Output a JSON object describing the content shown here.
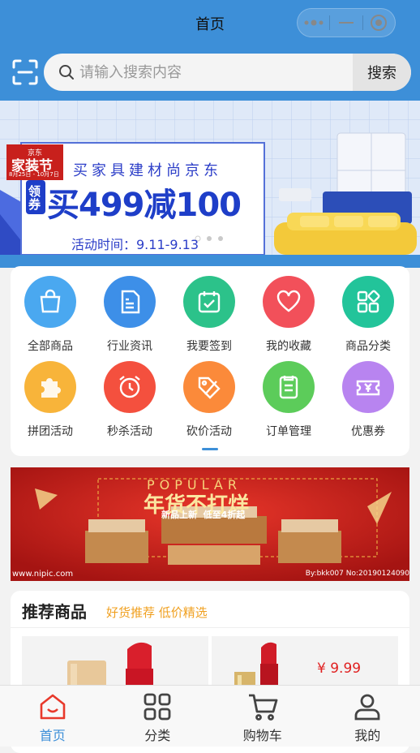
{
  "titlebar": {
    "title": "首页"
  },
  "search": {
    "placeholder": "请输入搜索内容",
    "button_label": "搜索"
  },
  "banner": {
    "brand_small": "京东",
    "brand_main": "家装节",
    "brand_date": "8月25日 - 10月7日",
    "headline": "买家具建材尚京东",
    "coupon_tag": "领券",
    "offer": "买499减100",
    "period": "活动时间：9.11-9.13"
  },
  "grid": {
    "items": [
      {
        "label": "全部商品",
        "icon": "shopping-bag-icon",
        "color": "#4aa8f0"
      },
      {
        "label": "行业资讯",
        "icon": "news-document-icon",
        "color": "#3d8fe8"
      },
      {
        "label": "我要签到",
        "icon": "calendar-check-icon",
        "color": "#2cc28a"
      },
      {
        "label": "我的收藏",
        "icon": "heart-icon",
        "color": "#f2505a"
      },
      {
        "label": "商品分类",
        "icon": "category-grid-icon",
        "color": "#22c49a"
      },
      {
        "label": "拼团活动",
        "icon": "puzzle-icon",
        "color": "#f8b43a"
      },
      {
        "label": "秒杀活动",
        "icon": "alarm-clock-icon",
        "color": "#f4503e"
      },
      {
        "label": "砍价活动",
        "icon": "price-tag-icon",
        "color": "#fb8a3a"
      },
      {
        "label": "订单管理",
        "icon": "order-list-icon",
        "color": "#5ccc5a"
      },
      {
        "label": "优惠券",
        "icon": "coupon-yen-icon",
        "color": "#b884f0"
      }
    ]
  },
  "promo": {
    "popular": "POPULAR",
    "title": "年货不打烊",
    "subtitle": "新品上新  低至4折起",
    "watermark_left": "www.nipic.com",
    "watermark_right": "By:bkk007 No:20190124090"
  },
  "recommend": {
    "title": "推荐商品",
    "subtitle": "好货推荐 低价精选",
    "products": [
      {
        "name": "lipstick-gold-red",
        "price": ""
      },
      {
        "name": "lipstick-ysl",
        "price": "¥ 9.99"
      }
    ]
  },
  "tabbar": {
    "items": [
      {
        "label": "首页",
        "icon": "home-icon",
        "active": true
      },
      {
        "label": "分类",
        "icon": "category-icon",
        "active": false
      },
      {
        "label": "购物车",
        "icon": "cart-icon",
        "active": false
      },
      {
        "label": "我的",
        "icon": "user-icon",
        "active": false
      }
    ]
  },
  "colors": {
    "primary": "#3d8fd8",
    "price": "#e02020",
    "accent": "#f0a020"
  }
}
